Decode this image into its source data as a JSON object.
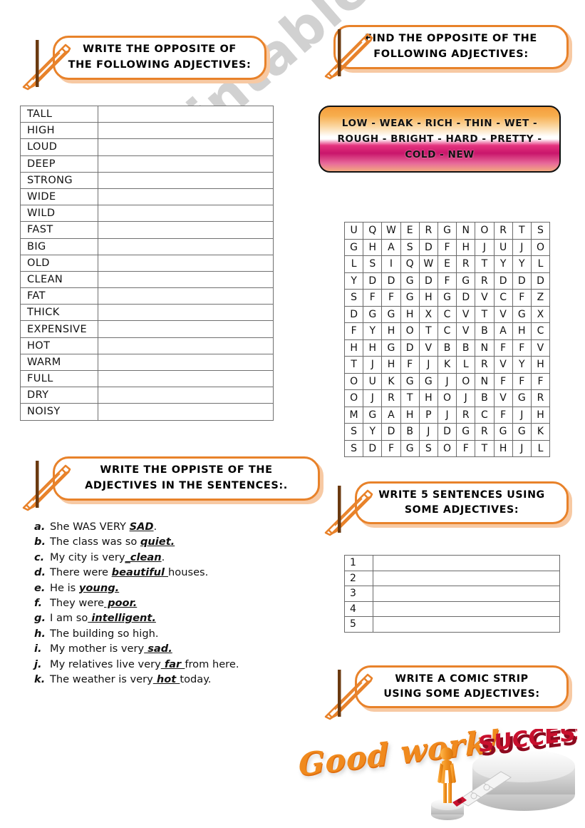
{
  "watermark": {
    "text": "Esl printables.com"
  },
  "headers": {
    "opposites_table": {
      "line1": "WRITE THE OPPOSITE OF",
      "line2": "THE FOLLOWING ADJECTIVES:"
    },
    "find_opposite": {
      "line1": "FIND THE OPPOSITE OF THE",
      "line2": "FOLLOWING ADJECTIVES:"
    },
    "sentences": {
      "line1": "WRITE THE OPPISTE OF THE",
      "line2": "ADJECTIVES IN THE SENTENCES:."
    },
    "five_sentences": {
      "line1": "WRITE 5 SENTENCES USING",
      "line2": "SOME ADJECTIVES:"
    },
    "comic_strip": {
      "line1": "WRITE A COMIC STRIP",
      "line2": "USING SOME ADJECTIVES:"
    }
  },
  "opposites_table": {
    "words": [
      "TALL",
      "HIGH",
      "LOUD",
      "DEEP",
      "STRONG",
      "WIDE",
      "WILD",
      "FAST",
      "BIG",
      "OLD",
      "CLEAN",
      "FAT",
      "THICK",
      "EXPENSIVE",
      "HOT",
      "WARM",
      "FULL",
      "DRY",
      "NOISY"
    ],
    "answers": [
      "",
      "",
      "",
      "",
      "",
      "",
      "",
      "",
      "",
      "",
      "",
      "",
      "",
      "",
      "",
      "",
      "",
      "",
      ""
    ]
  },
  "word_bank": {
    "line1": "LOW - WEAK - RICH - THIN - WET -",
    "line2": "ROUGH - BRIGHT - HARD - PRETTY -",
    "line3": "COLD - NEW",
    "words": [
      "LOW",
      "WEAK",
      "RICH",
      "THIN",
      "WET",
      "ROUGH",
      "BRIGHT",
      "HARD",
      "PRETTY",
      "COLD",
      "NEW"
    ]
  },
  "word_search": {
    "rows": 14,
    "cols": 11,
    "grid": [
      [
        "U",
        "Q",
        "W",
        "E",
        "R",
        "G",
        "N",
        "O",
        "R",
        "T",
        "S"
      ],
      [
        "G",
        "H",
        "A",
        "S",
        "D",
        "F",
        "H",
        "J",
        "U",
        "J",
        "O"
      ],
      [
        "L",
        "S",
        "I",
        "Q",
        "W",
        "E",
        "R",
        "T",
        "Y",
        "Y",
        "L"
      ],
      [
        "Y",
        "D",
        "D",
        "G",
        "D",
        "F",
        "G",
        "R",
        "D",
        "D",
        "D"
      ],
      [
        "S",
        "F",
        "F",
        "G",
        "H",
        "G",
        "D",
        "V",
        "C",
        "F",
        "Z"
      ],
      [
        "D",
        "G",
        "G",
        "H",
        "X",
        "C",
        "V",
        "T",
        "V",
        "G",
        "X"
      ],
      [
        "F",
        "Y",
        "H",
        "O",
        "T",
        "C",
        "V",
        "B",
        "A",
        "H",
        "C"
      ],
      [
        "H",
        "H",
        "G",
        "D",
        "V",
        "B",
        "B",
        "N",
        "F",
        "F",
        "V"
      ],
      [
        "T",
        "J",
        "H",
        "F",
        "J",
        "K",
        "L",
        "R",
        "V",
        "Y",
        "H"
      ],
      [
        "O",
        "U",
        "K",
        "G",
        "G",
        "J",
        "O",
        "N",
        "F",
        "F",
        "F"
      ],
      [
        "O",
        "J",
        "R",
        "T",
        "H",
        "O",
        "J",
        "B",
        "V",
        "G",
        "R"
      ],
      [
        "M",
        "G",
        "A",
        "H",
        "P",
        "J",
        "R",
        "C",
        "F",
        "J",
        "H"
      ],
      [
        "S",
        "Y",
        "D",
        "B",
        "J",
        "D",
        "G",
        "R",
        "G",
        "G",
        "K"
      ],
      [
        "S",
        "D",
        "F",
        "G",
        "S",
        "O",
        "F",
        "T",
        "H",
        "J",
        "L"
      ]
    ]
  },
  "sentences": [
    {
      "letter": "a.",
      "before": "She WAS VERY ",
      "adjective": "SAD",
      "after": "."
    },
    {
      "letter": "b.",
      "before": "The class was so ",
      "adjective": "quiet.",
      "after": ""
    },
    {
      "letter": "c.",
      "before": "My city is very",
      "adjective": "_clean",
      "after": "."
    },
    {
      "letter": "d.",
      "before": "There were ",
      "adjective": "beautiful ",
      "after": "houses."
    },
    {
      "letter": "e.",
      "before": "He is ",
      "adjective": "young.",
      "after": ""
    },
    {
      "letter": "f.",
      "before": "They were",
      "adjective": " poor.",
      "after": ""
    },
    {
      "letter": "g.",
      "before": "I am so",
      "adjective": " intelligent.",
      "after": ""
    },
    {
      "letter": "h.",
      "before": "The building so high.",
      "adjective": "",
      "after": ""
    },
    {
      "letter": "i.",
      "before": "My mother is very",
      "adjective": " sad.",
      "after": ""
    },
    {
      "letter": "j.",
      "before": "My relatives live very",
      "adjective": " far ",
      "after": "from here."
    },
    {
      "letter": "k.",
      "before": "The weather is very",
      "adjective": " hot ",
      "after": "today."
    }
  ],
  "five_sentences_table": {
    "numbers": [
      "1",
      "2",
      "3",
      "4",
      "5"
    ],
    "lines": [
      "",
      "",
      "",
      "",
      ""
    ]
  },
  "footer_art": {
    "good_work": "Good work!",
    "success": "SUCCESS"
  },
  "colors": {
    "accent_orange": "#E8822A",
    "banner_shadow": "#f7c9a3",
    "bank_orange": "#f59d3c",
    "bank_magenta": "#e4337e",
    "success_red": "#C8102E",
    "figure_orange": "#F0901E",
    "watermark_gray": "#c9c9c9"
  }
}
